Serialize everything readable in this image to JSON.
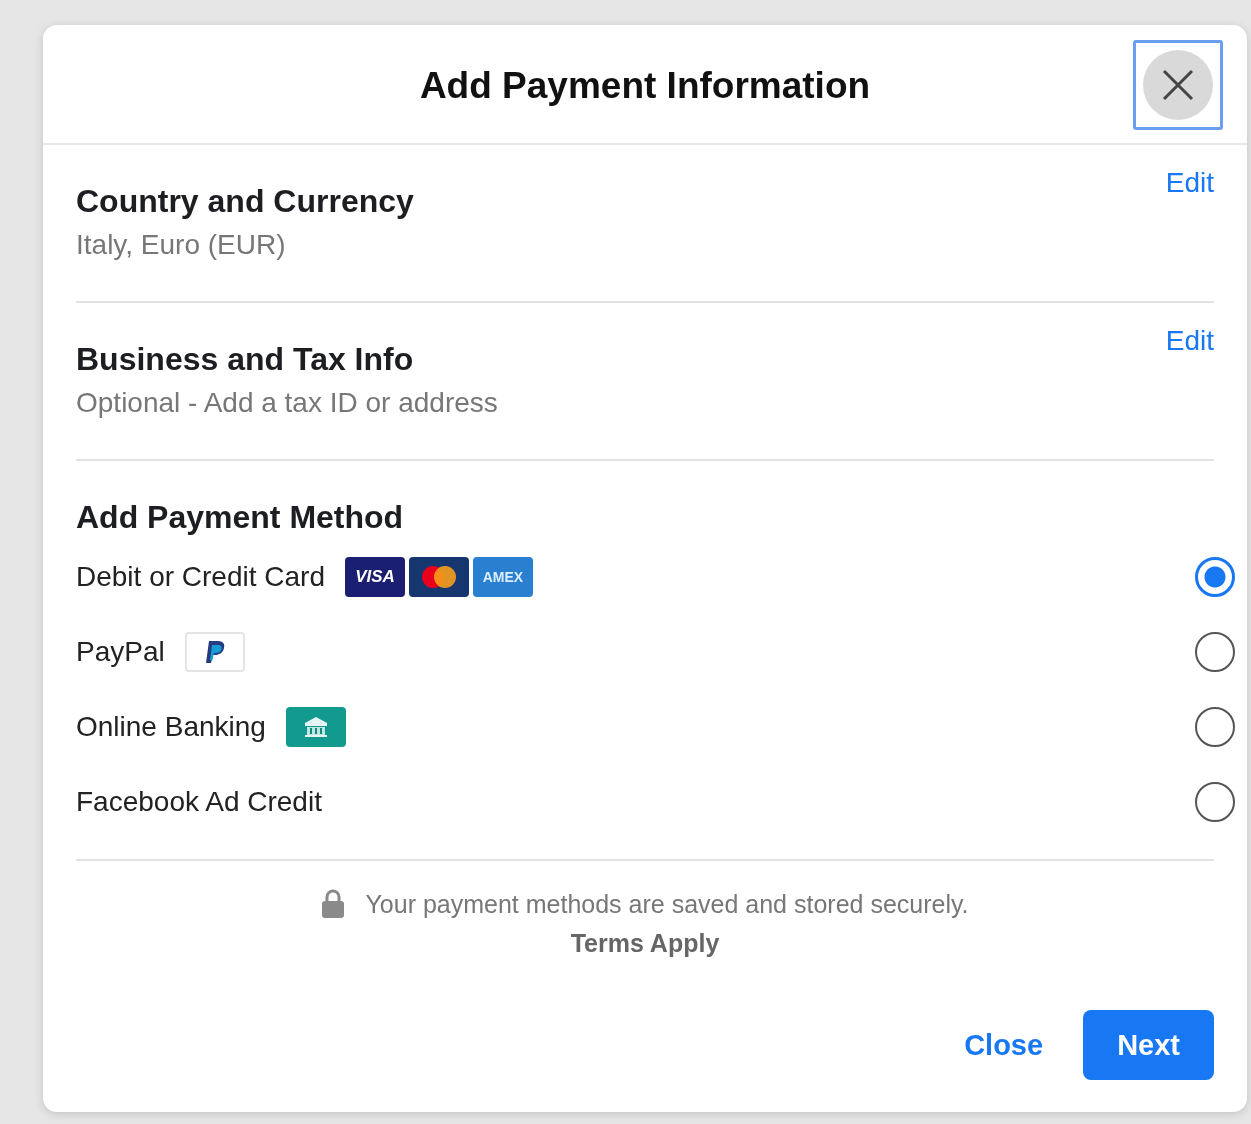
{
  "dialog": {
    "title": "Add Payment Information"
  },
  "sections": [
    {
      "heading": "Country and Currency",
      "detail": "Italy, Euro (EUR)",
      "action": "Edit"
    },
    {
      "heading": "Business and Tax Info",
      "detail": "Optional - Add a tax ID or address",
      "action": "Edit"
    }
  ],
  "payment": {
    "heading": "Add Payment Method",
    "methods": [
      {
        "label": "Debit or Credit Card",
        "selected": true,
        "badges": [
          {
            "kind": "visa",
            "text": "VISA"
          },
          {
            "kind": "mastercard"
          },
          {
            "kind": "amex",
            "text": "AMEX"
          }
        ]
      },
      {
        "label": "PayPal",
        "selected": false,
        "badges": [
          {
            "kind": "paypal"
          }
        ]
      },
      {
        "label": "Online Banking",
        "selected": false,
        "badges": [
          {
            "kind": "bank"
          }
        ]
      },
      {
        "label": "Facebook Ad Credit",
        "selected": false
      }
    ]
  },
  "security_note": "Your payment methods are saved and stored securely.",
  "terms": "Terms Apply",
  "buttons": [
    {
      "label": "Close",
      "kind": "link"
    },
    {
      "label": "Next",
      "kind": "primary"
    }
  ]
}
